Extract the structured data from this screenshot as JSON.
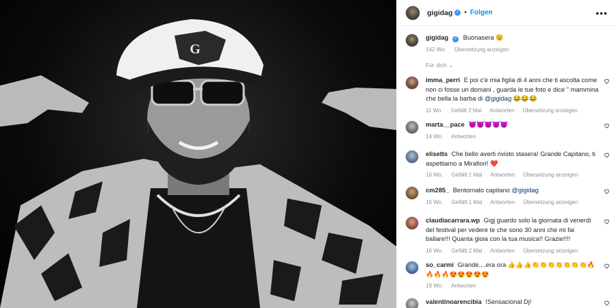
{
  "post": {
    "username": "gigidag",
    "follow_label": "Folgen",
    "more_label": "•••",
    "separator": "•"
  },
  "caption": {
    "username": "gigidag",
    "text": "Buonasera 😉",
    "time": "142 Wo.",
    "translate": "Übersetzung anzeigen"
  },
  "filter_label": "Für dich ⌄",
  "comments": [
    {
      "username": "imma_perri",
      "text": "E poi c'è mia figlia di 4 anni che ti ascolta come non ci fosse un domani , guarda le tue foto e dice \" mammina che bella la barba di",
      "mention": "@gigidag",
      "suffix": " 😂😂😂",
      "time": "11 Wo.",
      "likes": "Gefällt 2 Mal",
      "reply": "Antworten",
      "translate": "Übersetzung anzeigen"
    },
    {
      "username": "marta__pace",
      "text": "😈😈😈😈😈",
      "mention": "",
      "suffix": "",
      "time": "14 Wo.",
      "likes": "",
      "reply": "Antworten",
      "translate": ""
    },
    {
      "username": "elisetts",
      "text": "Che bello averti rivisto stasera! Grande Capitano, ti aspettiamo a Mirafiori! ❤️",
      "mention": "",
      "suffix": "",
      "time": "16 Wo.",
      "likes": "Gefällt 1 Mal",
      "reply": "Antworten",
      "translate": "Übersetzung anzeigen"
    },
    {
      "username": "cm285_",
      "text": "Bentornato capitano",
      "mention": "@gigidag",
      "suffix": "",
      "time": "16 Wo.",
      "likes": "Gefällt 1 Mal",
      "reply": "Antworten",
      "translate": "Übersetzung anzeigen"
    },
    {
      "username": "claudiacarrara.wp",
      "text": "Gigj guardo solo la giornata di venerdì del festival per vedere te che sono 30 anni che mi fai ballare!!! Quanta gioia con la tua musica!! Grazie!!!!",
      "mention": "",
      "suffix": "",
      "time": "16 Wo.",
      "likes": "Gefällt 2 Mal",
      "reply": "Antworten",
      "translate": "Übersetzung anzeigen"
    },
    {
      "username": "so_carmi",
      "text": "Grande....era ora 👍👍👍👏👏👏👏👏👏👏🔥🔥🔥🔥😍😍😍😍😍",
      "mention": "",
      "suffix": "",
      "time": "19 Wo.",
      "likes": "",
      "reply": "Antworten",
      "translate": ""
    },
    {
      "username": "valentinoarencibia",
      "text": "!Sensacional Dj!",
      "mention": "",
      "suffix": "",
      "time": "",
      "likes": "",
      "reply": "",
      "translate": ""
    }
  ],
  "colors": {
    "accent": "#0095f6",
    "verified": "#3897f0",
    "muted": "#8e8e8e"
  },
  "icons": {
    "heart": "heart-outline-icon",
    "verified": "verified-badge-icon",
    "more": "more-options-icon"
  }
}
